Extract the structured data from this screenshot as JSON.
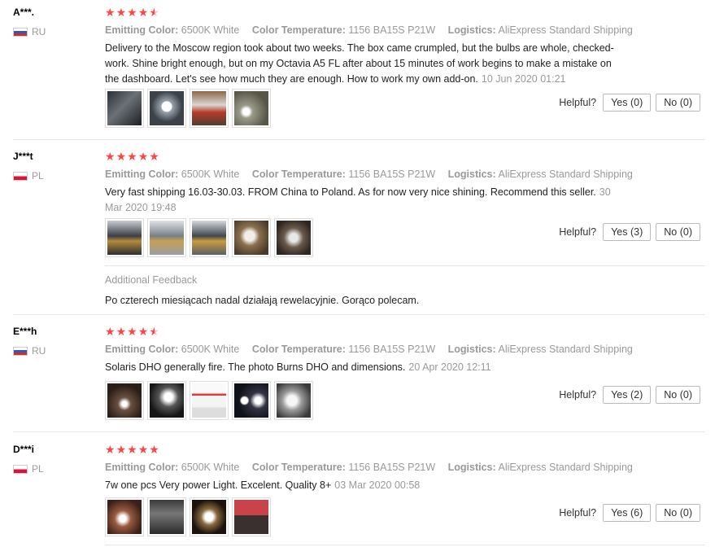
{
  "helpful_label": "Helpful?",
  "star_color": "#ff4444",
  "reviews": [
    {
      "user": "A***.",
      "country": "RU",
      "stars": 4.5,
      "meta": {
        "emitting_label": "Emitting Color:",
        "emitting_value": "6500K White",
        "temp_label": "Color Temperature:",
        "temp_value": "1156 BA15S P21W",
        "logistics_label": "Logistics:",
        "logistics_value": "AliExpress Standard Shipping"
      },
      "text": "Delivery to the Moscow region took about two weeks. The box came crumpled, but the bulbs are whole, checked-work. Shine bright enough, but on my Octavia A5 FL after about 15 minutes of work begins to make a mistake on the dashboard. Let's see how much they are enough. How to work my own add-on.",
      "date": "10 Jun 2020 01:21",
      "yes": "Yes (0)",
      "no": "No (0)"
    },
    {
      "user": "J***t",
      "country": "PL",
      "stars": 5,
      "meta": {
        "emitting_label": "Emitting Color:",
        "emitting_value": "6500K White",
        "temp_label": "Color Temperature:",
        "temp_value": "1156 BA15S P21W",
        "logistics_label": "Logistics:",
        "logistics_value": "AliExpress Standard Shipping"
      },
      "text": "Very fast shipping 16.03-30.03. FROM China to Poland. As for now very nice shining. Recommend this seller.",
      "date": "30 Mar 2020 19:48",
      "yes": "Yes (3)",
      "no": "No (0)",
      "additional_title": "Additional Feedback",
      "additional_text": "Po czterech miesiącach nadal działają rewelacyjnie. Gorąco polecam."
    },
    {
      "user": "E***h",
      "country": "RU",
      "stars": 4.5,
      "meta": {
        "emitting_label": "Emitting Color:",
        "emitting_value": "6500K White",
        "temp_label": "Color Temperature:",
        "temp_value": "1156 BA15S P21W",
        "logistics_label": "Logistics:",
        "logistics_value": "AliExpress Standard Shipping"
      },
      "text": "Solaris DHO generally fire. The photo Burns DHO and dimensions.",
      "date": "20 Apr 2020 12:11",
      "yes": "Yes (2)",
      "no": "No (0)"
    },
    {
      "user": "D***i",
      "country": "PL",
      "stars": 5,
      "meta": {
        "emitting_label": "Emitting Color:",
        "emitting_value": "6500K White",
        "temp_label": "Color Temperature:",
        "temp_value": "1156 BA15S P21W",
        "logistics_label": "Logistics:",
        "logistics_value": "AliExpress Standard Shipping"
      },
      "text": "7w one pcs Very power Light. Excelent. Quality 8+",
      "date": "03 Mar 2020 00:58",
      "yes": "Yes (6)",
      "no": "No (0)"
    }
  ]
}
